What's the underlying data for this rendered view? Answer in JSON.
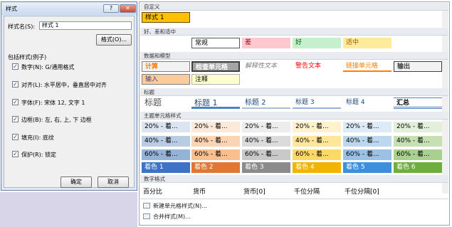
{
  "dialog": {
    "title": "样式",
    "help_icon": "?",
    "close_icon": "✕",
    "name_label": "样式名(S):",
    "name_value": "样式 1",
    "format_button": "格式(O)...",
    "includes_label": "包括样式(例子)",
    "options": [
      {
        "label": "数字(N): G/通用格式",
        "checked": true
      },
      {
        "label": "对齐(L): 水平居中，垂直居中对齐",
        "checked": true
      },
      {
        "label": "字体(F): 宋体 12, 文字 1",
        "checked": true
      },
      {
        "label": "边框(B): 左, 右, 上, 下 边框",
        "checked": true
      },
      {
        "label": "填充(I): 底纹",
        "checked": true
      },
      {
        "label": "保护(R): 锁定",
        "checked": true
      }
    ],
    "ok_label": "确定",
    "cancel_label": "取消"
  },
  "gallery": {
    "custom_header": "自定义",
    "custom_tiles": [
      {
        "label": "样式 1",
        "bg": "#ffc000"
      }
    ],
    "good_bad_header": "好、差和适中",
    "good_bad_tiles": [
      {
        "label": "常规",
        "bg": "#ffffff",
        "color": "#000000"
      },
      {
        "label": "差",
        "bg": "#ffc7ce",
        "color": "#9c0006"
      },
      {
        "label": "好",
        "bg": "#c6efce",
        "color": "#006100"
      },
      {
        "label": "适中",
        "bg": "#ffeb9c",
        "color": "#9c5700"
      }
    ],
    "data_model_header": "数据和模型",
    "data_model_row1": [
      {
        "label": "计算",
        "bg": "#f2f2f2",
        "color": "#fa7d00"
      },
      {
        "label": "检查单元格",
        "bg": "#a5a5a5",
        "color": "#ffffff"
      },
      {
        "label": "解释性文本",
        "bg": "#ffffff",
        "color": "#7f7f7f"
      },
      {
        "label": "警告文本",
        "bg": "#ffffff",
        "color": "#ff0000"
      },
      {
        "label": "链接单元格",
        "bg": "#ffffff",
        "color": "#fa7d00"
      },
      {
        "label": "输出",
        "bg": "#f2f2f2",
        "color": "#3f3f3f"
      }
    ],
    "data_model_row2": [
      {
        "label": "输入",
        "bg": "#ffcc99",
        "color": "#3f3f76"
      },
      {
        "label": "注释",
        "bg": "#ffffcc",
        "color": "#000000"
      }
    ],
    "titles_header": "标题",
    "titles": [
      "标题",
      "标题 1",
      "标题 2",
      "标题 3",
      "标题 4",
      "汇总"
    ],
    "theme_header": "主题单元格样式",
    "theme_rows": [
      [
        "20% - 着...",
        "20% - 着...",
        "20% - 着...",
        "20% - 着...",
        "20% - 着...",
        "20% - 着..."
      ],
      [
        "40% - 着...",
        "40% - 着...",
        "40% - 着...",
        "40% - 着...",
        "40% - 着...",
        "40% - 着..."
      ],
      [
        "60% - 着...",
        "60% - 着...",
        "60% - 着...",
        "60% - 着...",
        "60% - 着...",
        "60% - 着..."
      ],
      [
        "着色 1",
        "着色 2",
        "着色 3",
        "着色 4",
        "着色 5",
        "着色 6"
      ]
    ],
    "theme_colors": {
      "accent": [
        "#4f81bd",
        "#c0504d",
        "#9bbb59",
        "#8064a2",
        "#4bacc6",
        "#f79646"
      ],
      "accent_shown": [
        "#3d72c4",
        "#e07733",
        "#8b8b8b",
        "#f1b400",
        "#3d8fdc",
        "#6fae3e"
      ],
      "p20": [
        "#dbe5f1",
        "#fde9d9",
        "#ededed",
        "#fff2cc",
        "#ddebf7",
        "#e2efda"
      ],
      "p40": [
        "#b8cce4",
        "#fbd4b4",
        "#dbdbdb",
        "#ffe699",
        "#bdd7ee",
        "#c6e0b4"
      ],
      "p60": [
        "#95b3d7",
        "#fabf8f",
        "#c9c9c9",
        "#ffd966",
        "#9bc2e6",
        "#a9d08e"
      ]
    },
    "number_header": "数字格式",
    "number_formats": [
      "百分比",
      "货币",
      "货币[0]",
      "千位分隔",
      "千位分隔[0]"
    ],
    "menu": [
      {
        "label": "新建单元格样式(N)...",
        "icon": "new-style-icon"
      },
      {
        "label": "合并样式(M)...",
        "icon": "merge-styles-icon"
      }
    ]
  }
}
